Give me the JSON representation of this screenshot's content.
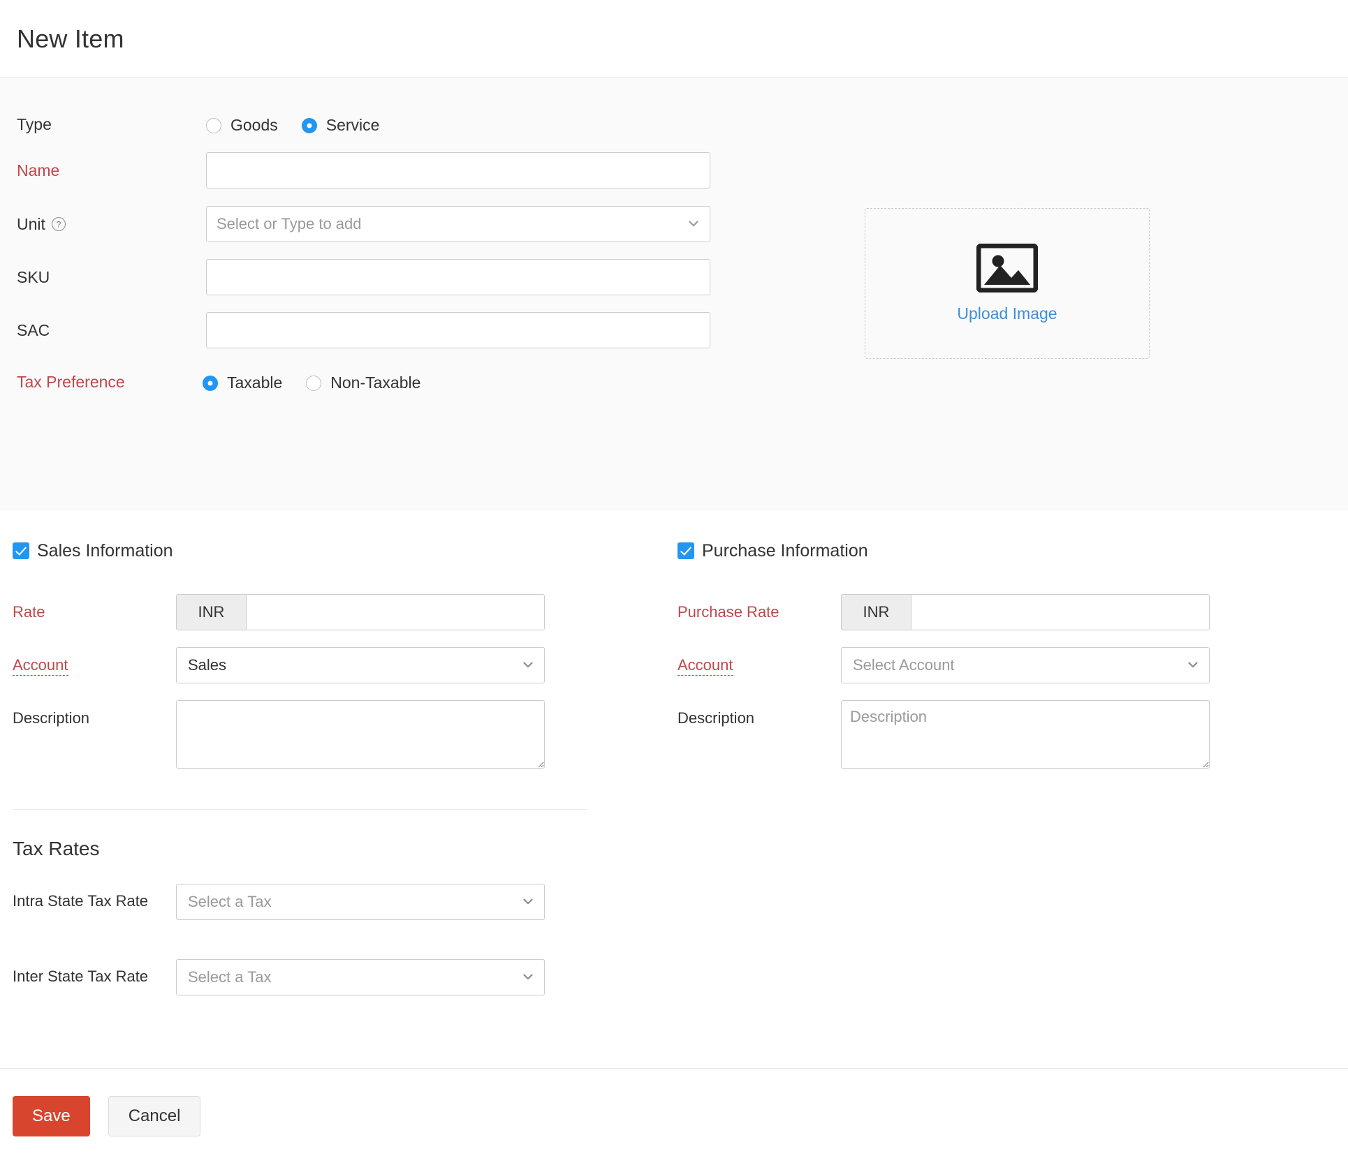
{
  "header": {
    "title": "New Item"
  },
  "basic": {
    "type": {
      "label": "Type",
      "options": [
        {
          "label": "Goods",
          "selected": false
        },
        {
          "label": "Service",
          "selected": true
        }
      ]
    },
    "name": {
      "label": "Name",
      "value": "",
      "required": true
    },
    "unit": {
      "label": "Unit",
      "placeholder": "Select or Type to add",
      "value": "",
      "help_icon": "question-mark-circle-icon"
    },
    "sku": {
      "label": "SKU",
      "value": ""
    },
    "sac": {
      "label": "SAC",
      "value": ""
    },
    "tax_preference": {
      "label": "Tax Preference",
      "options": [
        {
          "label": "Taxable",
          "selected": true
        },
        {
          "label": "Non-Taxable",
          "selected": false
        }
      ]
    }
  },
  "image_upload": {
    "icon": "image-placeholder-icon",
    "label": "Upload Image"
  },
  "sales": {
    "section_label": "Sales Information",
    "checked": true,
    "rate": {
      "label": "Rate",
      "currency": "INR",
      "value": "",
      "required": true
    },
    "account": {
      "label": "Account",
      "value": "Sales",
      "required": true
    },
    "description": {
      "label": "Description",
      "value": "",
      "placeholder": ""
    }
  },
  "purchase": {
    "section_label": "Purchase Information",
    "checked": true,
    "rate": {
      "label": "Purchase Rate",
      "currency": "INR",
      "value": "",
      "required": true
    },
    "account": {
      "label": "Account",
      "value": "",
      "placeholder": "Select Account",
      "required": true
    },
    "description": {
      "label": "Description",
      "value": "",
      "placeholder": "Description"
    }
  },
  "tax_rates": {
    "title": "Tax Rates",
    "intra": {
      "label": "Intra State Tax Rate",
      "value": "",
      "placeholder": "Select a Tax"
    },
    "inter": {
      "label": "Inter State Tax Rate",
      "value": "",
      "placeholder": "Select a Tax"
    }
  },
  "footer": {
    "save_label": "Save",
    "cancel_label": "Cancel"
  },
  "colors": {
    "accent_blue": "#2196f3",
    "required_red": "#c0474c",
    "save_red": "#d8452e",
    "link_blue": "#408dd6",
    "panel_gray": "#fafafa"
  }
}
